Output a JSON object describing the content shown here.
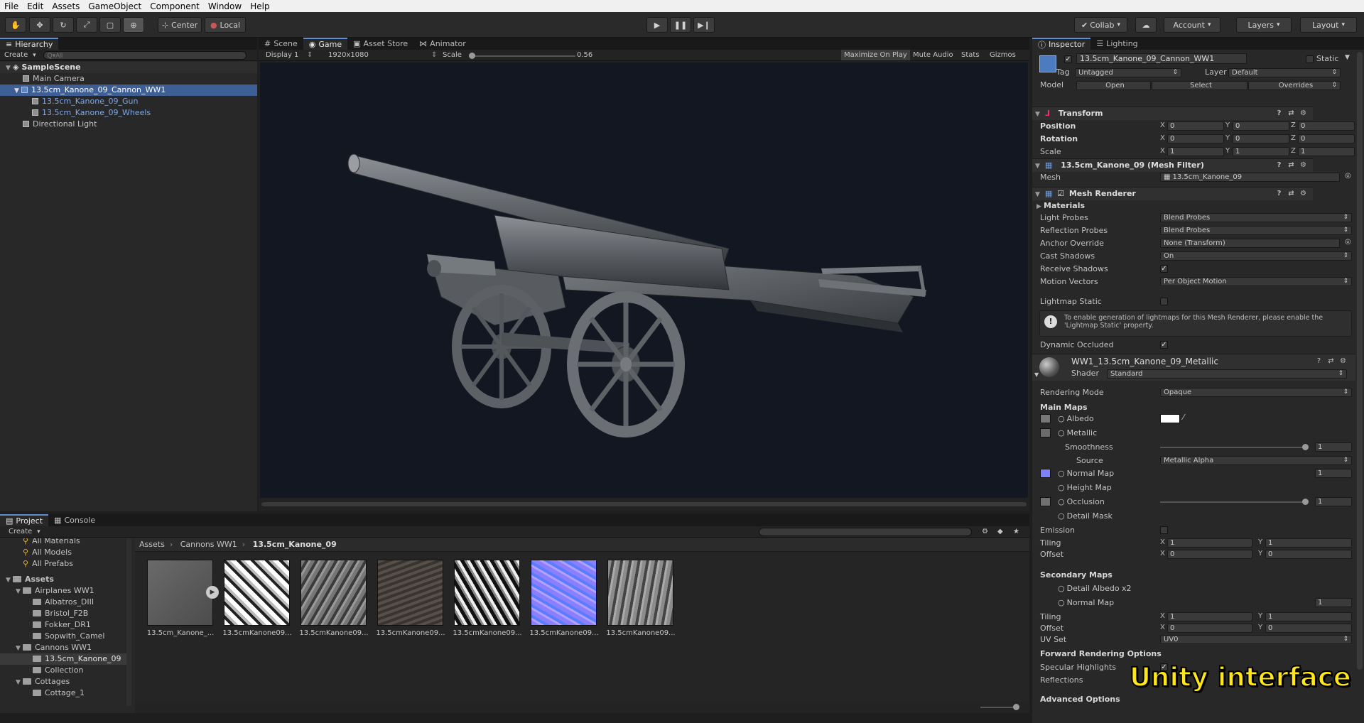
{
  "menu": [
    "File",
    "Edit",
    "Assets",
    "GameObject",
    "Component",
    "Window",
    "Help"
  ],
  "toolbar": {
    "tools": [
      "hand-icon",
      "move-icon",
      "rotate-icon",
      "scale-icon",
      "rect-icon",
      "transform-icon"
    ],
    "pivot": "Center",
    "space": "Local",
    "collab": "Collab",
    "account": "Account",
    "layers": "Layers",
    "layout": "Layout"
  },
  "hierarchy": {
    "tab": "Hierarchy",
    "create": "Create",
    "search_placeholder": "Q▾All",
    "scene": "SampleScene",
    "items": [
      {
        "label": "Main Camera"
      },
      {
        "label": "13.5cm_Kanone_09_Cannon_WW1"
      },
      {
        "label": "13.5cm_Kanone_09_Gun"
      },
      {
        "label": "13.5cm_Kanone_09_Wheels"
      },
      {
        "label": "Directional Light"
      }
    ]
  },
  "game": {
    "tabs": [
      "Scene",
      "Game",
      "Asset Store",
      "Animator"
    ],
    "display": "Display 1",
    "resolution": "1920x1080",
    "scale_label": "Scale",
    "scale_value": "0.56",
    "scale_fraction": 0.0,
    "buttons": [
      "Maximize On Play",
      "Mute Audio",
      "Stats",
      "Gizmos"
    ]
  },
  "project": {
    "tabs": [
      "Project",
      "Console"
    ],
    "create": "Create",
    "favorites": [
      "All Materials",
      "All Models",
      "All Prefabs"
    ],
    "tree": [
      {
        "label": "Assets",
        "level": 0,
        "bold": true,
        "open": true
      },
      {
        "label": "Airplanes WW1",
        "level": 1,
        "open": true
      },
      {
        "label": "Albatros_DIII",
        "level": 2
      },
      {
        "label": "Bristol_F2B",
        "level": 2
      },
      {
        "label": "Fokker_DR1",
        "level": 2
      },
      {
        "label": "Sopwith_Camel",
        "level": 2
      },
      {
        "label": "Cannons WW1",
        "level": 1,
        "open": true
      },
      {
        "label": "13.5cm_Kanone_09",
        "level": 2,
        "selected": true
      },
      {
        "label": "Collection",
        "level": 2
      },
      {
        "label": "Cottages",
        "level": 1,
        "open": true
      },
      {
        "label": "Cottage_1",
        "level": 2
      }
    ],
    "breadcrumb": [
      "Assets",
      "Cannons WW1",
      "13.5cm_Kanone_09"
    ],
    "assets": [
      {
        "label": "13.5cm_Kanone_..."
      },
      {
        "label": "13.5cmKanone09..."
      },
      {
        "label": "13.5cmKanone09..."
      },
      {
        "label": "13.5cmKanone09..."
      },
      {
        "label": "13.5cmKanone09..."
      },
      {
        "label": "13.5cmKanone09..."
      },
      {
        "label": "13.5cmKanone09..."
      }
    ]
  },
  "inspector": {
    "tabs": [
      "Inspector",
      "Lighting"
    ],
    "object_name": "13.5cm_Kanone_09_Cannon_WW1",
    "static_label": "Static",
    "tag_label": "Tag",
    "tag_value": "Untagged",
    "layer_label": "Layer",
    "layer_value": "Default",
    "model_label": "Model",
    "model_buttons": [
      "Open",
      "Select",
      "Overrides"
    ],
    "transform": {
      "title": "Transform",
      "rows": [
        {
          "label": "Position",
          "x": "0",
          "y": "0",
          "z": "0"
        },
        {
          "label": "Rotation",
          "x": "0",
          "y": "0",
          "z": "0"
        },
        {
          "label": "Scale",
          "x": "1",
          "y": "1",
          "z": "1"
        }
      ]
    },
    "mesh_filter": {
      "title": "13.5cm_Kanone_09 (Mesh Filter)",
      "mesh_label": "Mesh",
      "mesh_value": "13.5cm_Kanone_09"
    },
    "mesh_renderer": {
      "title": "Mesh Renderer",
      "materials": "Materials",
      "light_probes_label": "Light Probes",
      "light_probes": "Blend Probes",
      "reflection_probes_label": "Reflection Probes",
      "reflection_probes": "Blend Probes",
      "anchor_label": "Anchor Override",
      "anchor": "None (Transform)",
      "cast_label": "Cast Shadows",
      "cast": "On",
      "receive_label": "Receive Shadows",
      "motion_label": "Motion Vectors",
      "motion": "Per Object Motion",
      "lightmap_label": "Lightmap Static",
      "info": "To enable generation of lightmaps for this Mesh Renderer, please enable the 'Lightmap Static' property.",
      "occluded_label": "Dynamic Occluded"
    },
    "material": {
      "name": "WW1_13.5cm_Kanone_09_Metallic",
      "shader_label": "Shader",
      "shader": "Standard",
      "rendering_mode_label": "Rendering Mode",
      "rendering_mode": "Opaque",
      "main_maps": "Main Maps",
      "albedo": "Albedo",
      "metallic": "Metallic",
      "smoothness": "Smoothness",
      "smoothness_value": "1",
      "source": "Source",
      "source_value": "Metallic Alpha",
      "normal": "Normal Map",
      "normal_value": "1",
      "height": "Height Map",
      "occlusion": "Occlusion",
      "occlusion_value": "1",
      "detail_mask": "Detail Mask",
      "emission": "Emission",
      "tiling": "Tiling",
      "offset": "Offset",
      "tiling_x": "1",
      "tiling_y": "1",
      "offset_x": "0",
      "offset_y": "0",
      "secondary": "Secondary Maps",
      "detail_albedo": "Detail Albedo x2",
      "normal2": "Normal Map",
      "normal2_value": "1",
      "tiling2_x": "1",
      "tiling2_y": "1",
      "offset2_x": "0",
      "offset2_y": "0",
      "uv_label": "UV Set",
      "uv": "UV0",
      "forward": "Forward Rendering Options",
      "specular": "Specular Highlights",
      "reflections": "Reflections",
      "advanced": "Advanced Options"
    }
  },
  "overlay_caption": "Unity interface",
  "colors": {
    "accent": "#3e5f96",
    "normal_swatch": "#8080ff",
    "panel": "#282828"
  }
}
